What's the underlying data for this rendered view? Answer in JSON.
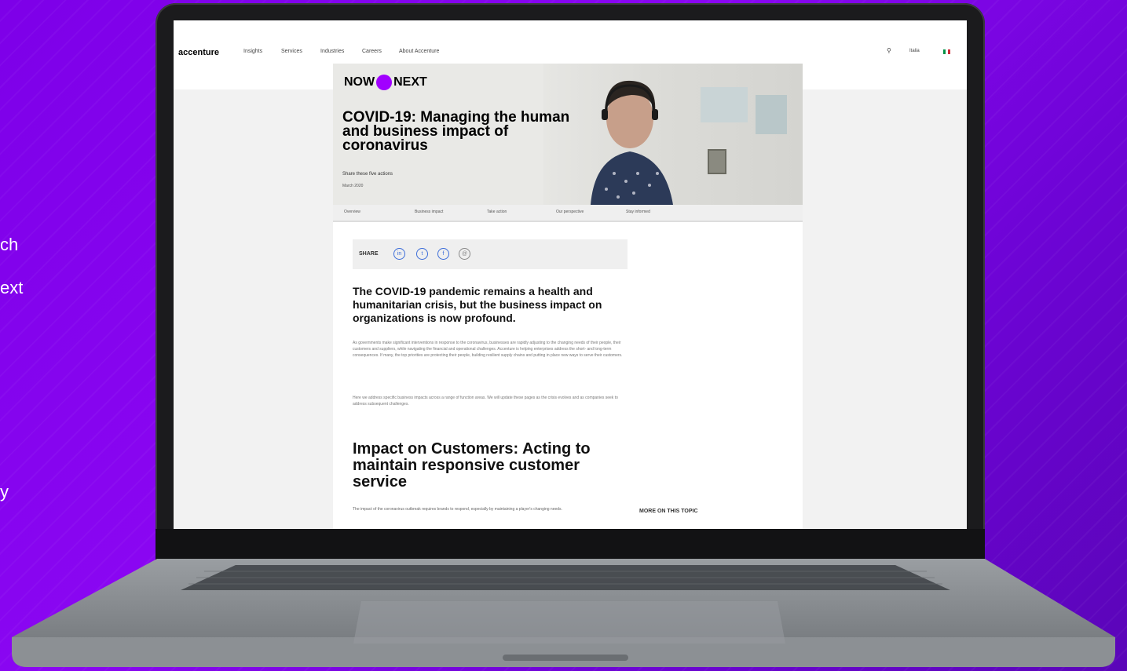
{
  "side_text": [
    "ch",
    "ext",
    "y"
  ],
  "nav": {
    "logo": "accenture",
    "items": [
      "Insights",
      "Services",
      "Industries",
      "Careers",
      "About Accenture"
    ],
    "search_icon": "search-icon",
    "region": "Italia",
    "flag_colors": [
      "#009246",
      "#ffffff",
      "#ce2b37"
    ]
  },
  "hero": {
    "brand_left": "NOW",
    "brand_right": "NEXT",
    "title": "COVID-19: Managing the human and business impact of coronavirus",
    "subtitle": "Share these five actions",
    "date": "March 2020"
  },
  "subnav": [
    "Overview",
    "Business impact",
    "Take action",
    "Our perspective",
    "Stay informed"
  ],
  "share": {
    "label": "SHARE",
    "icons": [
      "linkedin-icon",
      "twitter-icon",
      "facebook-icon",
      "email-icon"
    ],
    "glyphs": [
      "in",
      "t",
      "f",
      "@"
    ]
  },
  "article": {
    "lead": "The COVID-19 pandemic remains a health and humanitarian crisis, but the business impact on organizations is now profound.",
    "para1": "As governments make significant interventions in response to the coronavirus, businesses are rapidly adjusting to the changing needs of their people, their customers and suppliers, while navigating the financial and operational challenges. Accenture is helping enterprises address the short- and long-term consequences. If many, the top priorities are protecting their people, building resilient supply chains and putting in place new ways to serve their customers.",
    "para2": "Here we address specific business impacts across a range of function areas. We will update these pages as the crisis evolves and as companies seek to address subsequent challenges.",
    "heading": "Impact on Customers: Acting to maintain responsive customer service",
    "para3": "The impact of the coronavirus outbreak requires brands to respond, especially by maintaining a player's changing needs.",
    "more": "MORE ON THIS TOPIC"
  }
}
